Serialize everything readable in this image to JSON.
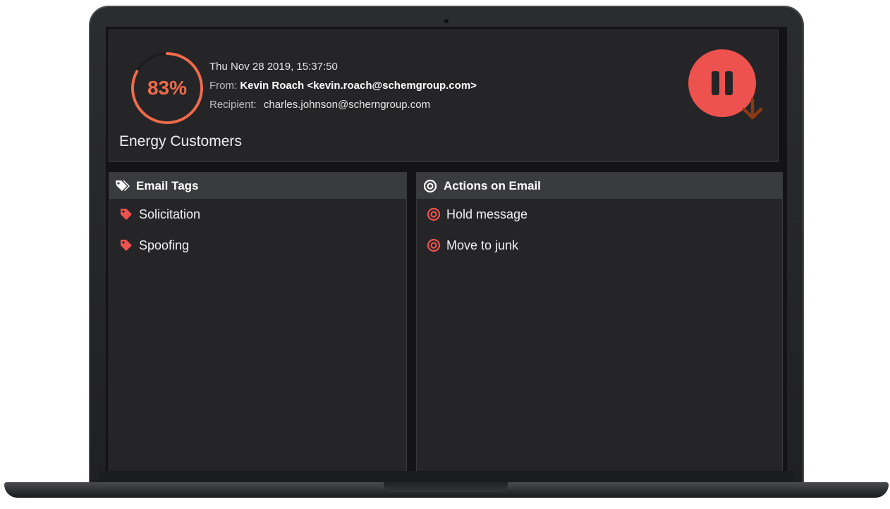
{
  "email": {
    "risk_score": "83%",
    "risk_fraction": 0.83,
    "date": "Thu Nov 28 2019, 15:37:50",
    "from_label": "From:",
    "from_value": "Kevin Roach <kevin.roach@schemgroup.com>",
    "recipient_label": "Recipient:",
    "recipient_value": "charles.johnson@scherngroup.com",
    "group": "Energy Customers"
  },
  "controls": {
    "pause_icon": "pause-icon",
    "download_icon": "arrow-down-icon"
  },
  "tags_panel": {
    "title": "Email Tags",
    "icon": "tags-icon",
    "items": [
      {
        "label": "Solicitation",
        "icon": "tag-icon"
      },
      {
        "label": "Spoofing",
        "icon": "tag-icon"
      }
    ]
  },
  "actions_panel": {
    "title": "Actions on Email",
    "icon": "target-icon",
    "items": [
      {
        "label": "Hold message",
        "icon": "target-icon"
      },
      {
        "label": "Move to junk",
        "icon": "target-icon"
      }
    ]
  },
  "colors": {
    "accent": "#ef6b4a",
    "pause_button": "#ee524e",
    "panel_bg": "#252527",
    "panel_header": "#3a3b3f",
    "arrow": "#8a3a12"
  }
}
